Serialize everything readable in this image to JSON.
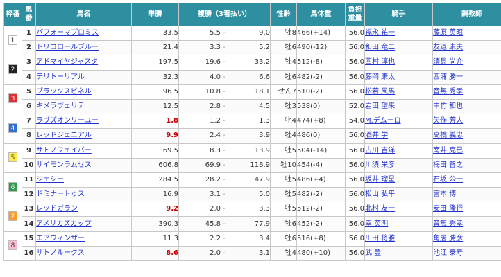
{
  "headers": {
    "waku": "枠番",
    "umaban_line1": "馬",
    "umaban_line2": "番",
    "horse": "馬名",
    "win": "単勝",
    "place": "複勝（3着払い）",
    "sexage": "性齢",
    "weight": "馬体重",
    "load_line1": "負担",
    "load_line2": "重量",
    "jockey": "騎手",
    "trainer": "調教師"
  },
  "frame_colors": {
    "1": {
      "bg": "#ffffff",
      "fg": "#333333"
    },
    "2": {
      "bg": "#222222",
      "fg": "#ffffff"
    },
    "3": {
      "bg": "#e03030",
      "fg": "#ffffff"
    },
    "4": {
      "bg": "#2f6fd6",
      "fg": "#ffffff"
    },
    "5": {
      "bg": "#ffe94a",
      "fg": "#333333"
    },
    "6": {
      "bg": "#2f9a4a",
      "fg": "#ffffff"
    },
    "7": {
      "bg": "#ff9a28",
      "fg": "#ffffff"
    },
    "8": {
      "bg": "#ffb8cc",
      "fg": "#333333"
    }
  },
  "rows": [
    {
      "waku": "1",
      "num": "1",
      "horse": "パフォーマプロミス",
      "win": "33.5",
      "fav": false,
      "place_min": "5.5",
      "place_max": "9.0",
      "sexage": "牡8",
      "weight": "466(+14)",
      "load": "56.0",
      "jockey": "福永 祐一",
      "trainer": "藤原 英昭"
    },
    {
      "waku": "1",
      "num": "2",
      "horse": "トリコロールブルー",
      "win": "21.4",
      "fav": false,
      "place_min": "3.3",
      "place_max": "5.2",
      "sexage": "牡6",
      "weight": "490(-12)",
      "load": "56.0",
      "jockey": "和田 竜二",
      "trainer": "友道 康夫"
    },
    {
      "waku": "2",
      "num": "3",
      "horse": "アドマイヤジャスタ",
      "win": "197.5",
      "fav": false,
      "place_min": "19.6",
      "place_max": "33.2",
      "sexage": "牡4",
      "weight": "512(-8)",
      "load": "56.0",
      "jockey": "西村 淳也",
      "trainer": "須貝 尚介"
    },
    {
      "waku": "2",
      "num": "4",
      "horse": "テリトーリアル",
      "win": "32.3",
      "fav": false,
      "place_min": "4.0",
      "place_max": "6.6",
      "sexage": "牡6",
      "weight": "482(-2)",
      "load": "56.0",
      "jockey": "藤岡 康太",
      "trainer": "西浦 勝一"
    },
    {
      "waku": "3",
      "num": "5",
      "horse": "ブラックスピネル",
      "win": "96.5",
      "fav": false,
      "place_min": "10.8",
      "place_max": "18.1",
      "sexage": "せん7",
      "weight": "510(-2)",
      "load": "56.0",
      "jockey": "松若 風馬",
      "trainer": "音無 秀孝"
    },
    {
      "waku": "3",
      "num": "6",
      "horse": "キメラヴェリテ",
      "win": "12.5",
      "fav": false,
      "place_min": "2.8",
      "place_max": "4.5",
      "sexage": "牡3",
      "weight": "538(0)",
      "load": "52.0",
      "jockey": "岩田 望来",
      "trainer": "中竹 和也"
    },
    {
      "waku": "4",
      "num": "7",
      "horse": "ラヴズオンリーユー",
      "win": "1.8",
      "fav": true,
      "place_min": "1.2",
      "place_max": "1.3",
      "sexage": "牝4",
      "weight": "474(+8)",
      "load": "54.0",
      "jockey": "M.デムーロ",
      "trainer": "矢作 芳人"
    },
    {
      "waku": "4",
      "num": "8",
      "horse": "レッドジェニアル",
      "win": "9.9",
      "fav": true,
      "place_min": "2.4",
      "place_max": "3.9",
      "sexage": "牡4",
      "weight": "486(0)",
      "load": "56.0",
      "jockey": "酒井 学",
      "trainer": "高橋 義忠"
    },
    {
      "waku": "5",
      "num": "9",
      "horse": "サトノフェイバー",
      "win": "69.5",
      "fav": false,
      "place_min": "8.3",
      "place_max": "13.9",
      "sexage": "牡5",
      "weight": "504(-14)",
      "load": "56.0",
      "jockey": "古川 吉洋",
      "trainer": "南井 克巳"
    },
    {
      "waku": "5",
      "num": "10",
      "horse": "サイモンラムセス",
      "win": "606.8",
      "fav": false,
      "place_min": "69.9",
      "place_max": "118.9",
      "sexage": "牡10",
      "weight": "454(-4)",
      "load": "56.0",
      "jockey": "川須 栄彦",
      "trainer": "梅田 智之"
    },
    {
      "waku": "6",
      "num": "11",
      "horse": "ジェシー",
      "win": "284.5",
      "fav": false,
      "place_min": "28.2",
      "place_max": "47.9",
      "sexage": "牡5",
      "weight": "486(+4)",
      "load": "56.0",
      "jockey": "坂井 瑠星",
      "trainer": "石坂 公一"
    },
    {
      "waku": "6",
      "num": "12",
      "horse": "ドミナートゥス",
      "win": "16.9",
      "fav": false,
      "place_min": "3.1",
      "place_max": "5.0",
      "sexage": "牡5",
      "weight": "482(-2)",
      "load": "56.0",
      "jockey": "松山 弘平",
      "trainer": "宮本 博"
    },
    {
      "waku": "7",
      "num": "13",
      "horse": "レッドガラン",
      "win": "9.2",
      "fav": true,
      "place_min": "2.0",
      "place_max": "3.3",
      "sexage": "牡5",
      "weight": "512(-2)",
      "load": "56.0",
      "jockey": "北村 友一",
      "trainer": "安田 隆行"
    },
    {
      "waku": "7",
      "num": "14",
      "horse": "アメリカズカップ",
      "win": "390.3",
      "fav": false,
      "place_min": "45.8",
      "place_max": "77.9",
      "sexage": "牡6",
      "weight": "452(-2)",
      "load": "56.0",
      "jockey": "幸 英明",
      "trainer": "音無 秀孝"
    },
    {
      "waku": "8",
      "num": "15",
      "horse": "エアウィンザー",
      "win": "11.3",
      "fav": false,
      "place_min": "2.2",
      "place_max": "3.4",
      "sexage": "牡6",
      "weight": "516(+8)",
      "load": "56.0",
      "jockey": "川田 将雅",
      "trainer": "角居 勝彦"
    },
    {
      "waku": "8",
      "num": "16",
      "horse": "サトノルークス",
      "win": "8.6",
      "fav": true,
      "place_min": "2.0",
      "place_max": "3.1",
      "sexage": "牡4",
      "weight": "480(+10)",
      "load": "56.0",
      "jockey": "武 豊",
      "trainer": "池江 泰寿"
    }
  ]
}
